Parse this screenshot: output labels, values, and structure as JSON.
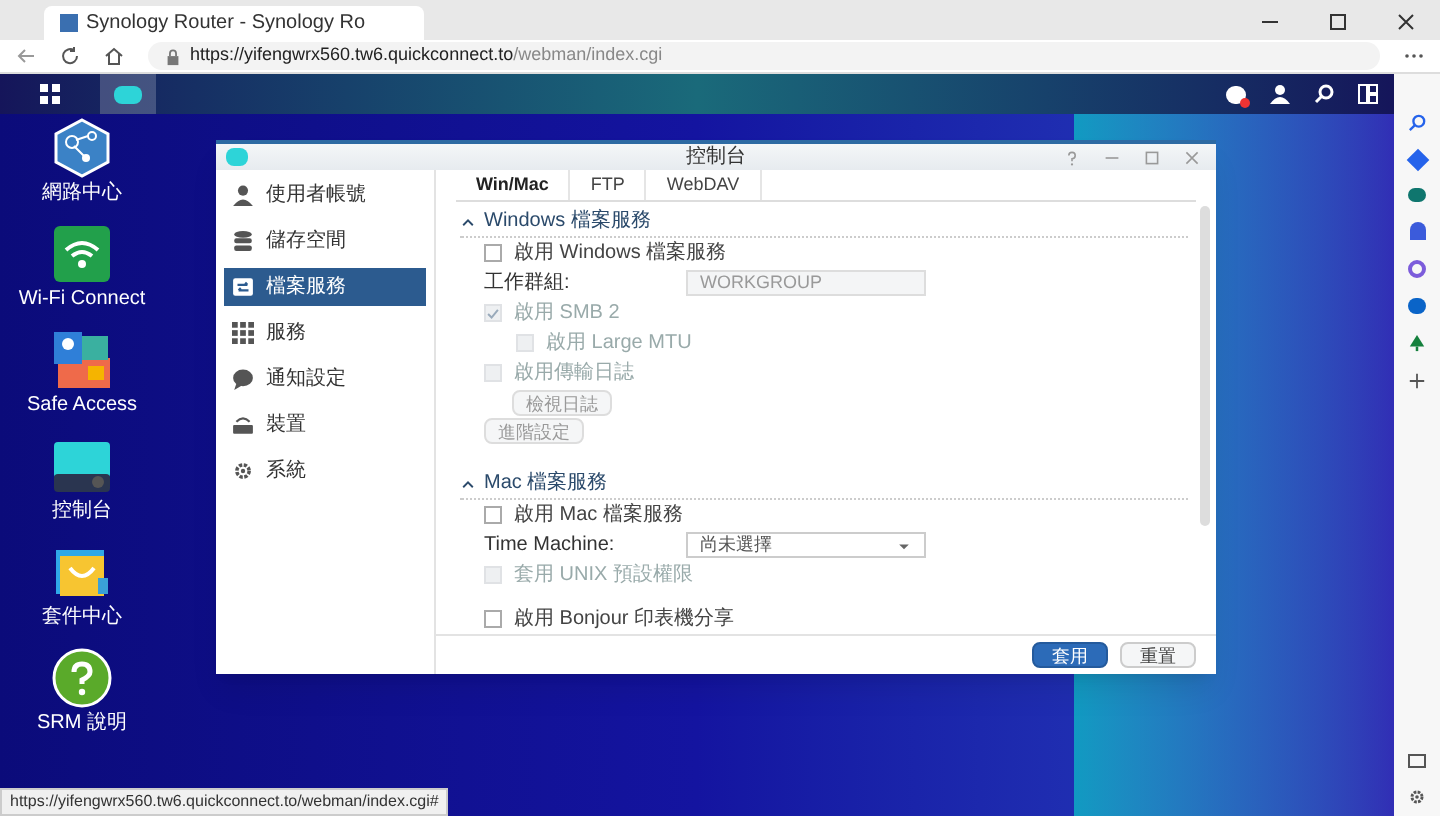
{
  "browser": {
    "tab_title": "Synology Router - Synology Ro",
    "url_host": "https://yifengwrx560.tw6.quickconnect.to",
    "url_path": "/webman/index.cgi"
  },
  "desktop_icons": [
    {
      "label": "網路中心",
      "kind": "network"
    },
    {
      "label": "Wi-Fi Connect",
      "kind": "wifi"
    },
    {
      "label": "Safe Access",
      "kind": "safe"
    },
    {
      "label": "控制台",
      "kind": "control"
    },
    {
      "label": "套件中心",
      "kind": "package"
    },
    {
      "label": "SRM 說明",
      "kind": "help"
    }
  ],
  "window": {
    "title": "控制台",
    "sidebar": [
      {
        "label": "使用者帳號",
        "kind": "user",
        "selected": false
      },
      {
        "label": "儲存空間",
        "kind": "storage",
        "selected": false
      },
      {
        "label": "檔案服務",
        "kind": "file",
        "selected": true
      },
      {
        "label": "服務",
        "kind": "grid",
        "selected": false
      },
      {
        "label": "通知設定",
        "kind": "chat",
        "selected": false
      },
      {
        "label": "裝置",
        "kind": "router",
        "selected": false
      },
      {
        "label": "系統",
        "kind": "gear",
        "selected": false
      }
    ],
    "tabs": [
      {
        "label": "Win/Mac",
        "selected": true
      },
      {
        "label": "FTP",
        "selected": false
      },
      {
        "label": "WebDAV",
        "selected": false
      }
    ],
    "sections": [
      {
        "title": "Windows 檔案服務",
        "rows": [
          {
            "kind": "checkbox",
            "label": "啟用 Windows 檔案服務",
            "checked": false,
            "disabled": false,
            "indent": false
          },
          {
            "kind": "field",
            "label": "工作群組:",
            "value": "WORKGROUP",
            "disabled": true
          },
          {
            "kind": "checkbox",
            "label": "啟用 SMB 2",
            "checked": true,
            "disabled": true,
            "indent": false
          },
          {
            "kind": "checkbox",
            "label": "啟用 Large MTU",
            "checked": false,
            "disabled": true,
            "indent": true
          },
          {
            "kind": "checkbox",
            "label": "啟用傳輸日誌",
            "checked": false,
            "disabled": true,
            "indent": false
          },
          {
            "kind": "button",
            "label": "檢視日誌",
            "indent": true
          },
          {
            "kind": "button",
            "label": "進階設定",
            "indent": false
          }
        ]
      },
      {
        "title": "Mac 檔案服務",
        "rows": [
          {
            "kind": "checkbox",
            "label": "啟用 Mac 檔案服務",
            "checked": false,
            "disabled": false,
            "indent": false
          },
          {
            "kind": "select",
            "label": "Time Machine:",
            "value": "尚未選擇",
            "disabled": false
          },
          {
            "kind": "checkbox",
            "label": "套用 UNIX 預設權限",
            "checked": false,
            "disabled": true,
            "indent": false
          }
        ]
      },
      {
        "rows": [
          {
            "kind": "checkbox",
            "label": "啟用 Bonjour 印表機分享",
            "checked": false,
            "disabled": false,
            "indent": false
          }
        ]
      }
    ],
    "buttons": [
      {
        "label": "套用",
        "kind": "primary"
      },
      {
        "label": "重置",
        "kind": "secondary"
      }
    ]
  },
  "status_url": "https://yifengwrx560.tw6.quickconnect.to/webman/index.cgi#"
}
